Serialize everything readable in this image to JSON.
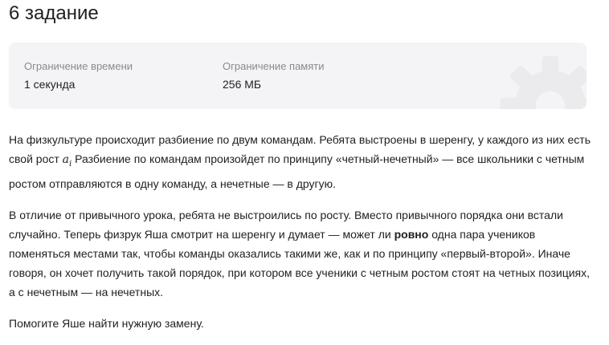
{
  "task": {
    "title": "6 задание"
  },
  "limits": {
    "time_label": "Ограничение времени",
    "time_value": "1 секунда",
    "memory_label": "Ограничение памяти",
    "memory_value": "256 МБ",
    "background_icon": "gear-icon"
  },
  "statement": {
    "p1_before": "На физкультуре происходит разбиение по двум командам. Ребята выстроены в шеренгу, у каждого из них есть свой рост ",
    "p1_var": "a",
    "p1_sub": "i",
    "p1_after": " Разбиение по командам произойдет по принципу «четный-нечетный» — все школьники с четным ростом отправляются в одну команду, а нечетные — в другую.",
    "p2_before": "В отличие от привычного урока, ребята не выстроились по росту. Вместо привычного порядка они встали случайно. Теперь физрук Яша смотрит на шеренгу и думает — может ли ",
    "p2_bold": "ровно",
    "p2_after": " одна пара учеников поменяться местами так, чтобы команды оказались такими же, как и по принципу «первый-второй». Иначе говоря, он хочет получить такой порядок, при котором все ученики с четным ростом стоят на четных позициях, а с нечетным — на нечетных.",
    "p3": "Помогите Яше найти нужную замену."
  },
  "colors": {
    "card_background": "#f4f4f6",
    "label_text": "#8a8a8f",
    "main_text": "#1f1f1f",
    "gear_watermark": "#ebebee"
  }
}
